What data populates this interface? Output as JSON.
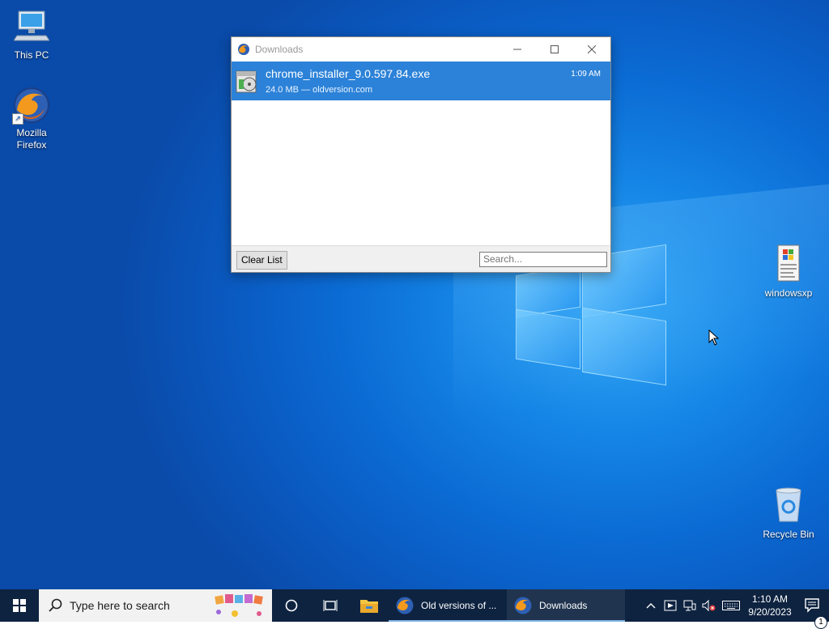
{
  "desktop": {
    "icons": [
      {
        "label": "This PC"
      },
      {
        "label": "Mozilla Firefox"
      },
      {
        "label": "windowsxp"
      },
      {
        "label": "Recycle Bin"
      }
    ]
  },
  "downloads_window": {
    "title": "Downloads",
    "item": {
      "filename": "chrome_installer_9.0.597.84.exe",
      "meta": "24.0 MB — oldversion.com",
      "time": "1:09 AM"
    },
    "clear_button": "Clear List",
    "search_placeholder": "Search..."
  },
  "taskbar": {
    "search_placeholder": "Type here to search",
    "apps": [
      {
        "label": "Old versions of ..."
      },
      {
        "label": "Downloads"
      }
    ],
    "clock_time": "1:10 AM",
    "clock_date": "9/20/2023",
    "notification_count": "1"
  },
  "colors": {
    "selection": "#2c82d8",
    "taskbar": "#0e2340",
    "desktop": "#0b6bd4"
  }
}
